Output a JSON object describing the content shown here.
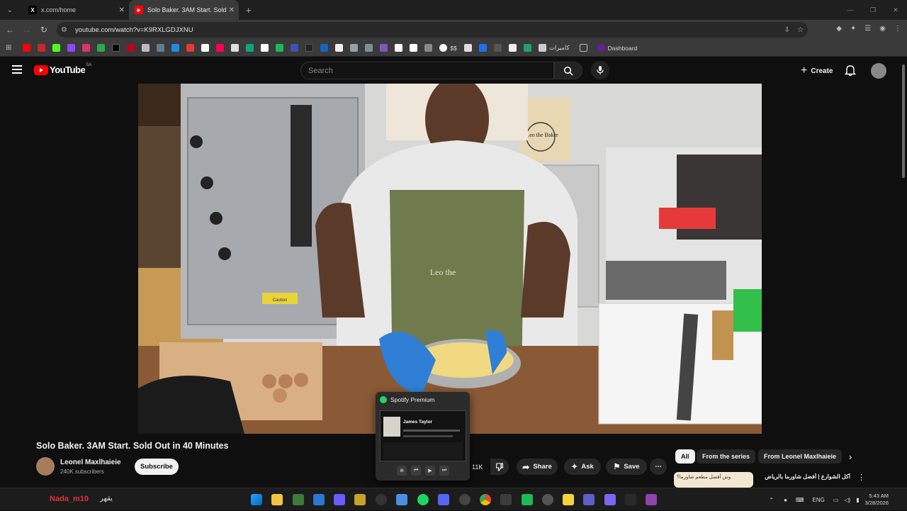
{
  "browser": {
    "tabs": [
      {
        "label": "x.com/home",
        "active": false
      },
      {
        "label": "Solo Baker. 3AM Start. Sold Out",
        "active": true
      }
    ],
    "url": "youtube.com/watch?v=K9RXLGDJXNU",
    "bookmarks": [
      {
        "label": "$$"
      },
      {
        "label": "كاميرات"
      },
      {
        "label": "Dashboard"
      }
    ]
  },
  "youtube": {
    "logo_text": "YouTube",
    "country_code": "SA",
    "search_placeholder": "Search",
    "create_label": "Create",
    "video": {
      "title": "Solo Baker. 3AM Start. Sold Out in 40 Minutes",
      "channel": "Leonel Maxlhaieie",
      "subscribers": "240K subscribers",
      "subscribe_label": "Subscribe",
      "likes": "11K",
      "share_label": "Share",
      "ask_label": "Ask",
      "save_label": "Save",
      "scene": {
        "apron_text": "Leo the",
        "bag_text": "Leo the Baker",
        "caution_text": "Caution"
      }
    },
    "chips": [
      "All",
      "From the series",
      "From Leonel Maxlhaieie"
    ],
    "related": {
      "title": "أكل الشوارع | أفضل شاورما بالرياض",
      "thumb_text": "وش أفضل مطعم شاورما؟"
    }
  },
  "spotify_popup": {
    "title": "Spotify Premium",
    "preview_text": "James Taylor"
  },
  "taskbar": {
    "user_label": "Nada_m10",
    "user_label_ar": "يقهر",
    "language": "ENG",
    "time": "5:43 AM",
    "date": "3/28/2026"
  },
  "colors": {
    "yt_red": "#ff0000",
    "background": "#0f0f0f",
    "spotify_green": "#1ed760"
  }
}
